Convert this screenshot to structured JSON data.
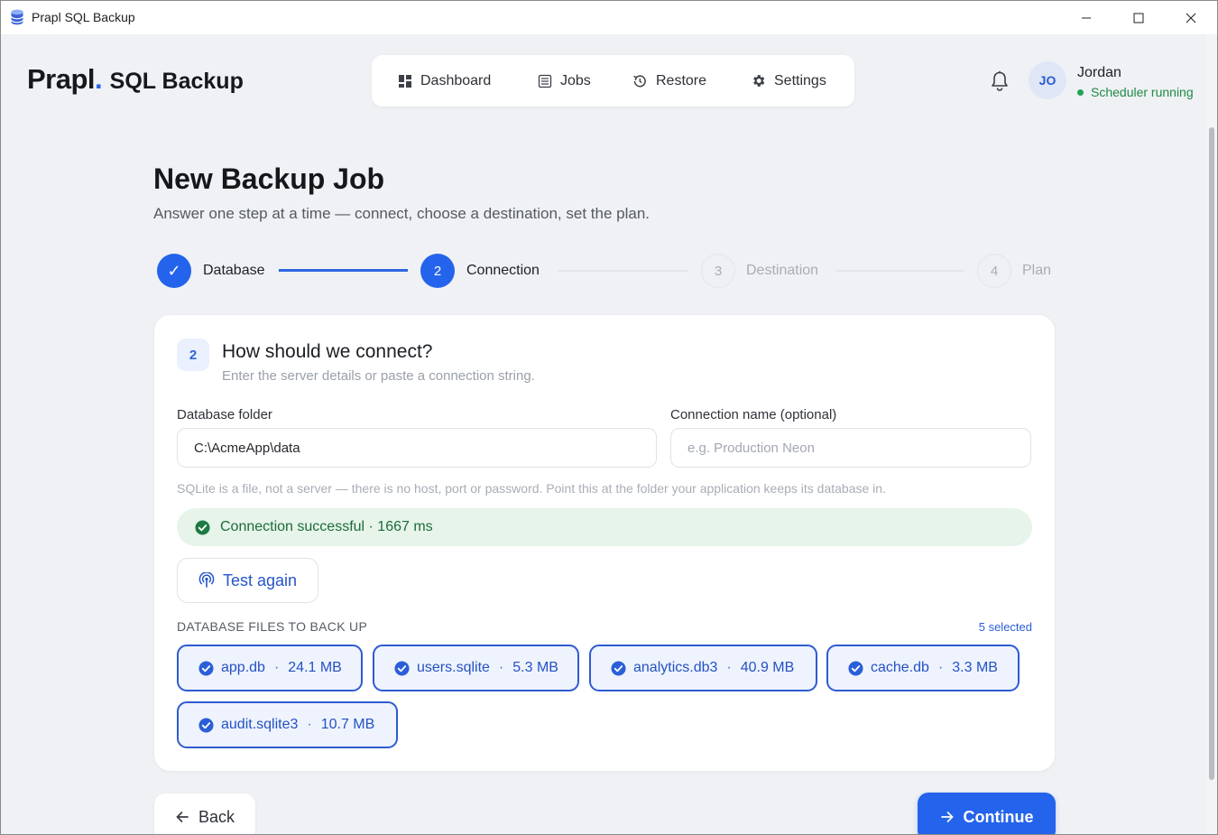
{
  "window": {
    "title": "Prapl SQL Backup"
  },
  "brand": {
    "name": "Prapl",
    "dot": ".",
    "product": "SQL Backup",
    "accent_color": "#2463eb"
  },
  "nav": {
    "items": [
      {
        "label": "Dashboard",
        "icon": "grid-icon"
      },
      {
        "label": "Jobs",
        "icon": "list-icon"
      },
      {
        "label": "Restore",
        "icon": "restore-icon"
      },
      {
        "label": "Settings",
        "icon": "gear-icon"
      }
    ]
  },
  "user": {
    "initials": "JO",
    "name": "Jordan",
    "status": "Scheduler running",
    "status_color": "#22a356"
  },
  "page": {
    "title": "New Backup Job",
    "subtitle": "Answer one step at a time — connect, choose a destination, set the plan."
  },
  "stepper": {
    "steps": [
      {
        "number": "✓",
        "label": "Database",
        "state": "done"
      },
      {
        "number": "2",
        "label": "Connection",
        "state": "active"
      },
      {
        "number": "3",
        "label": "Destination",
        "state": "todo"
      },
      {
        "number": "4",
        "label": "Plan",
        "state": "todo"
      }
    ]
  },
  "card": {
    "step_badge": "2",
    "title": "How should we connect?",
    "subtitle": "Enter the server details or paste a connection string.",
    "folder_label": "Database folder",
    "folder_value": "C:\\AcmeApp\\data",
    "name_label": "Connection name (optional)",
    "name_placeholder": "e.g. Production Neon",
    "hint": "SQLite is a file, not a server — there is no host, port or password. Point this at the folder your application keeps its database in.",
    "success_message": "Connection successful · 1667 ms",
    "test_button": "Test again",
    "files_heading": "DATABASE FILES TO BACK UP",
    "files_selected": "5 selected",
    "files": [
      {
        "name": "app.db",
        "size": "24.1 MB",
        "checked": true
      },
      {
        "name": "users.sqlite",
        "size": "5.3 MB",
        "checked": true
      },
      {
        "name": "analytics.db3",
        "size": "40.9 MB",
        "checked": true
      },
      {
        "name": "cache.db",
        "size": "3.3 MB",
        "checked": true
      },
      {
        "name": "audit.sqlite3",
        "size": "10.7 MB",
        "checked": true
      }
    ]
  },
  "footer": {
    "back_label": "Back",
    "continue_label": "Continue"
  }
}
